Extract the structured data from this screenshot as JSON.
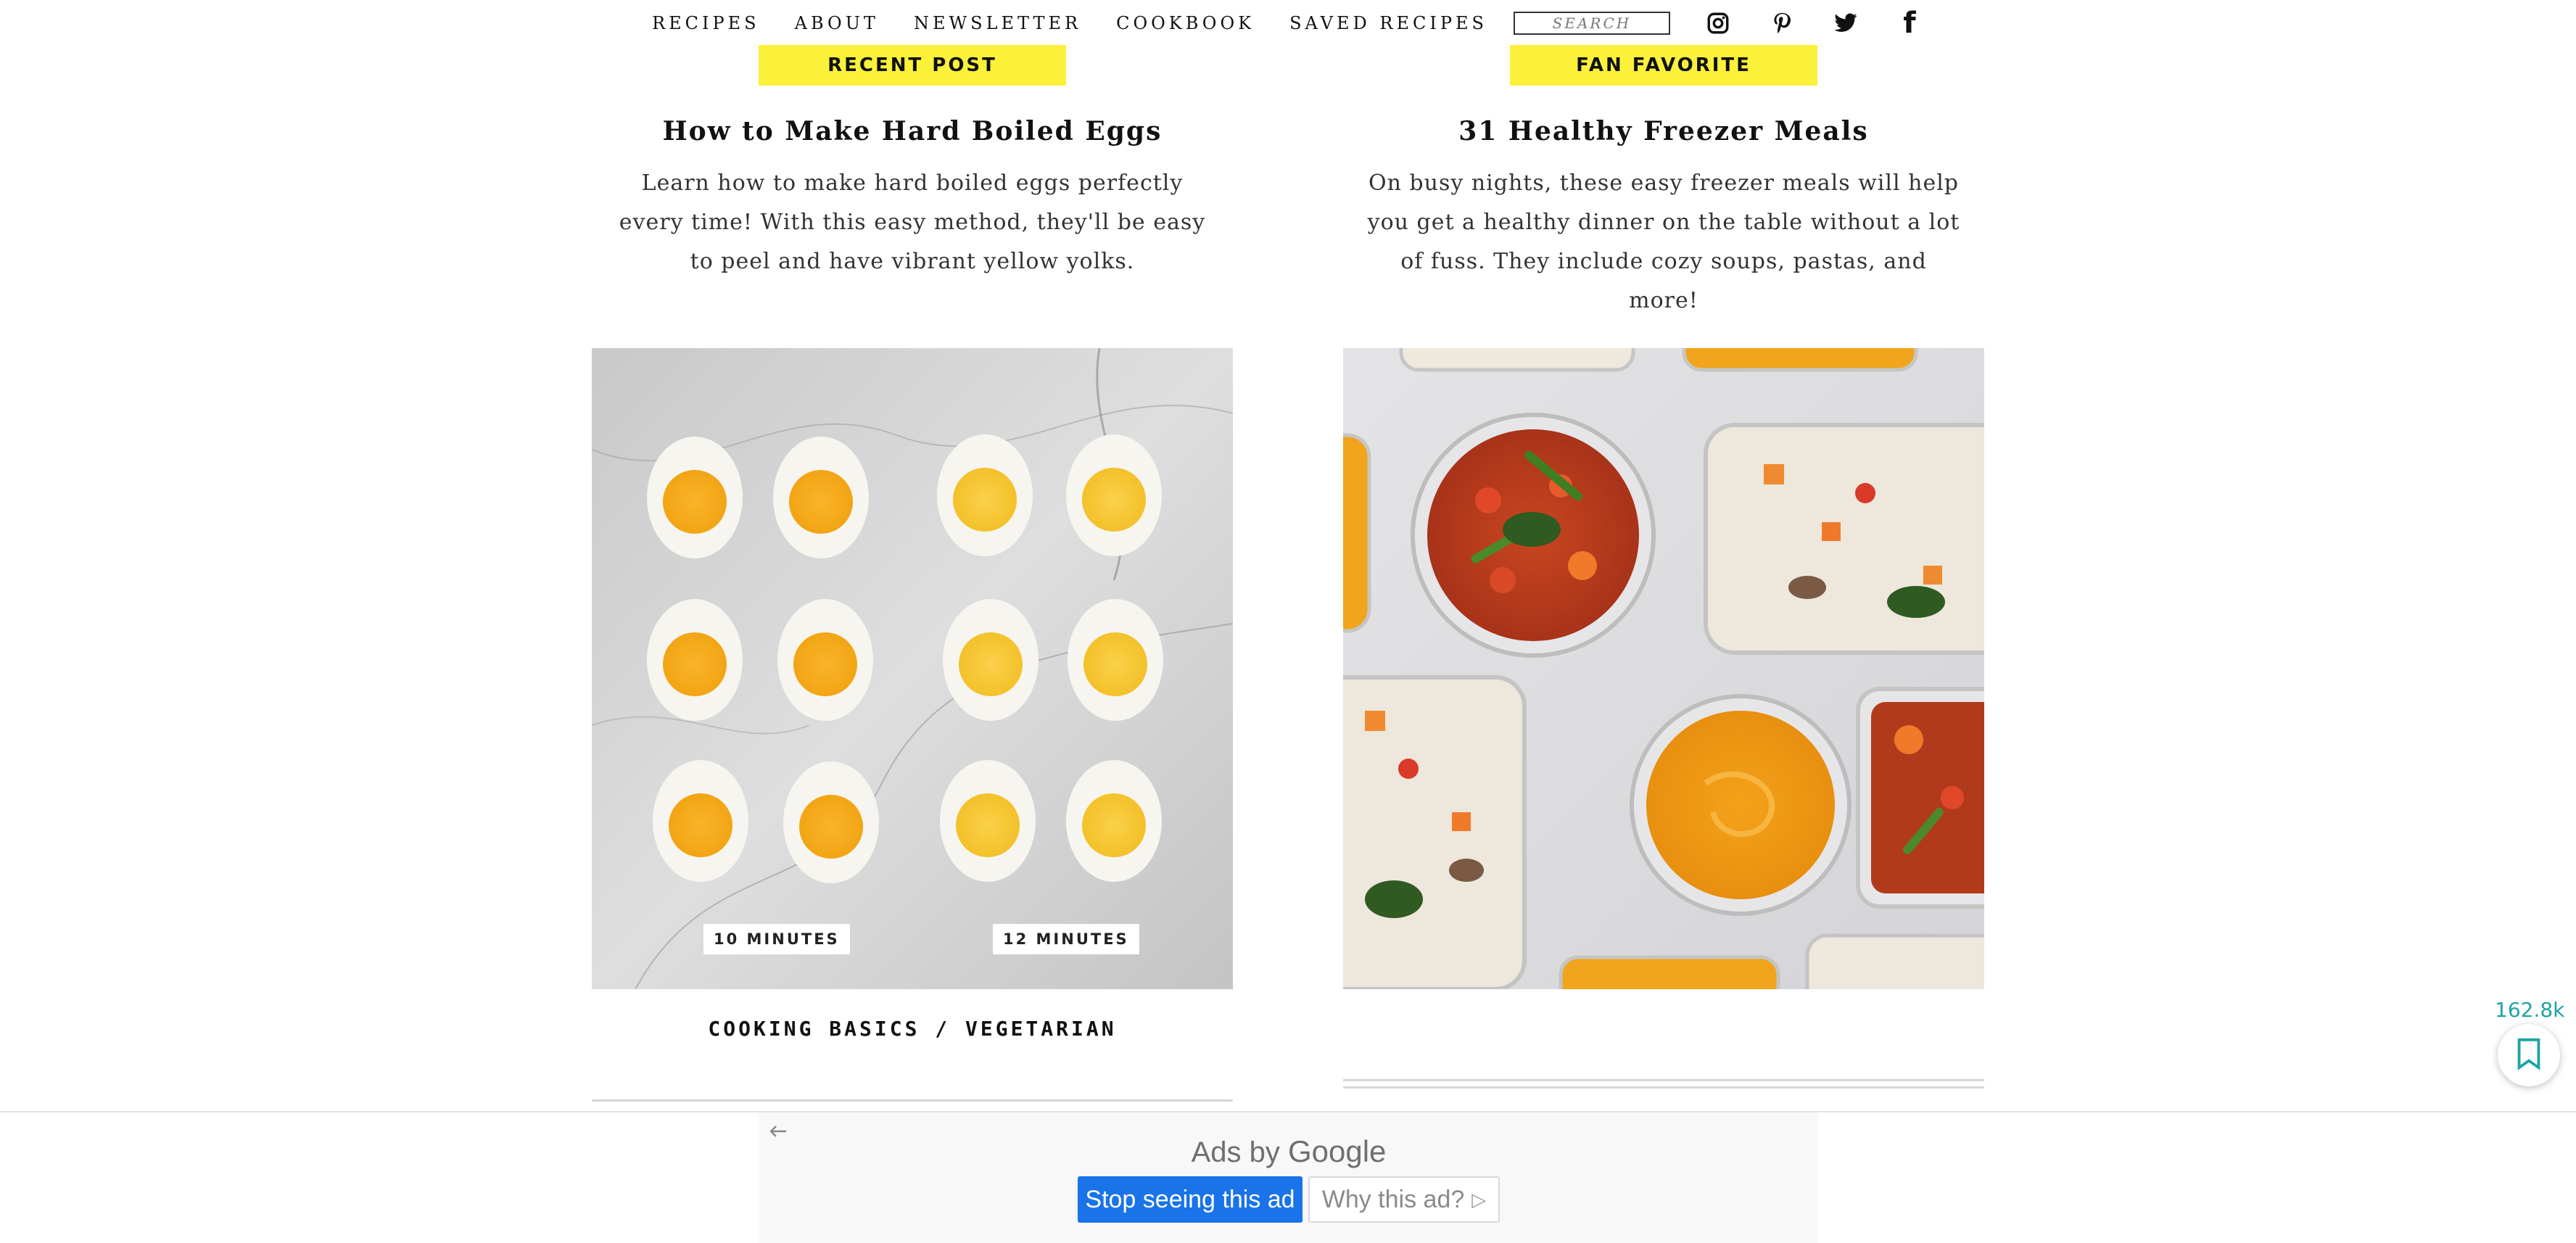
{
  "nav": {
    "items": [
      "RECIPES",
      "ABOUT",
      "NEWSLETTER",
      "COOKBOOK",
      "SAVED RECIPES"
    ],
    "search_placeholder": "SEARCH",
    "social_icons": [
      "instagram-icon",
      "pinterest-icon",
      "twitter-icon",
      "facebook-icon"
    ]
  },
  "posts": [
    {
      "badge": "RECENT POST",
      "title": "How to Make Hard Boiled Eggs",
      "excerpt": "Learn how to make hard boiled eggs perfectly every time! With this easy method, they'll be easy to peel and have vibrant yellow yolks.",
      "image_labels": [
        "10 MINUTES",
        "12 MINUTES"
      ],
      "category": "COOKING BASICS / VEGETARIAN"
    },
    {
      "badge": "FAN FAVORITE",
      "title": "31 Healthy Freezer Meals",
      "excerpt": "On busy nights, these easy freezer meals will help you get a healthy dinner on the table without a lot of fuss. They include cozy soups, pastas, and more!",
      "category": ""
    }
  ],
  "save_widget": {
    "count": "162.8k",
    "icon": "bookmark-icon"
  },
  "ad": {
    "ads_by": "Ads by",
    "brand": "Google",
    "stop_button": "Stop seeing this ad",
    "why_button": "Why this ad?",
    "why_glyph": "▷",
    "back_icon": "back-arrow-icon"
  },
  "colors": {
    "badge_yellow": "#fbf13a",
    "save_teal": "#1fa3a3",
    "ad_blue": "#1a73e8"
  }
}
